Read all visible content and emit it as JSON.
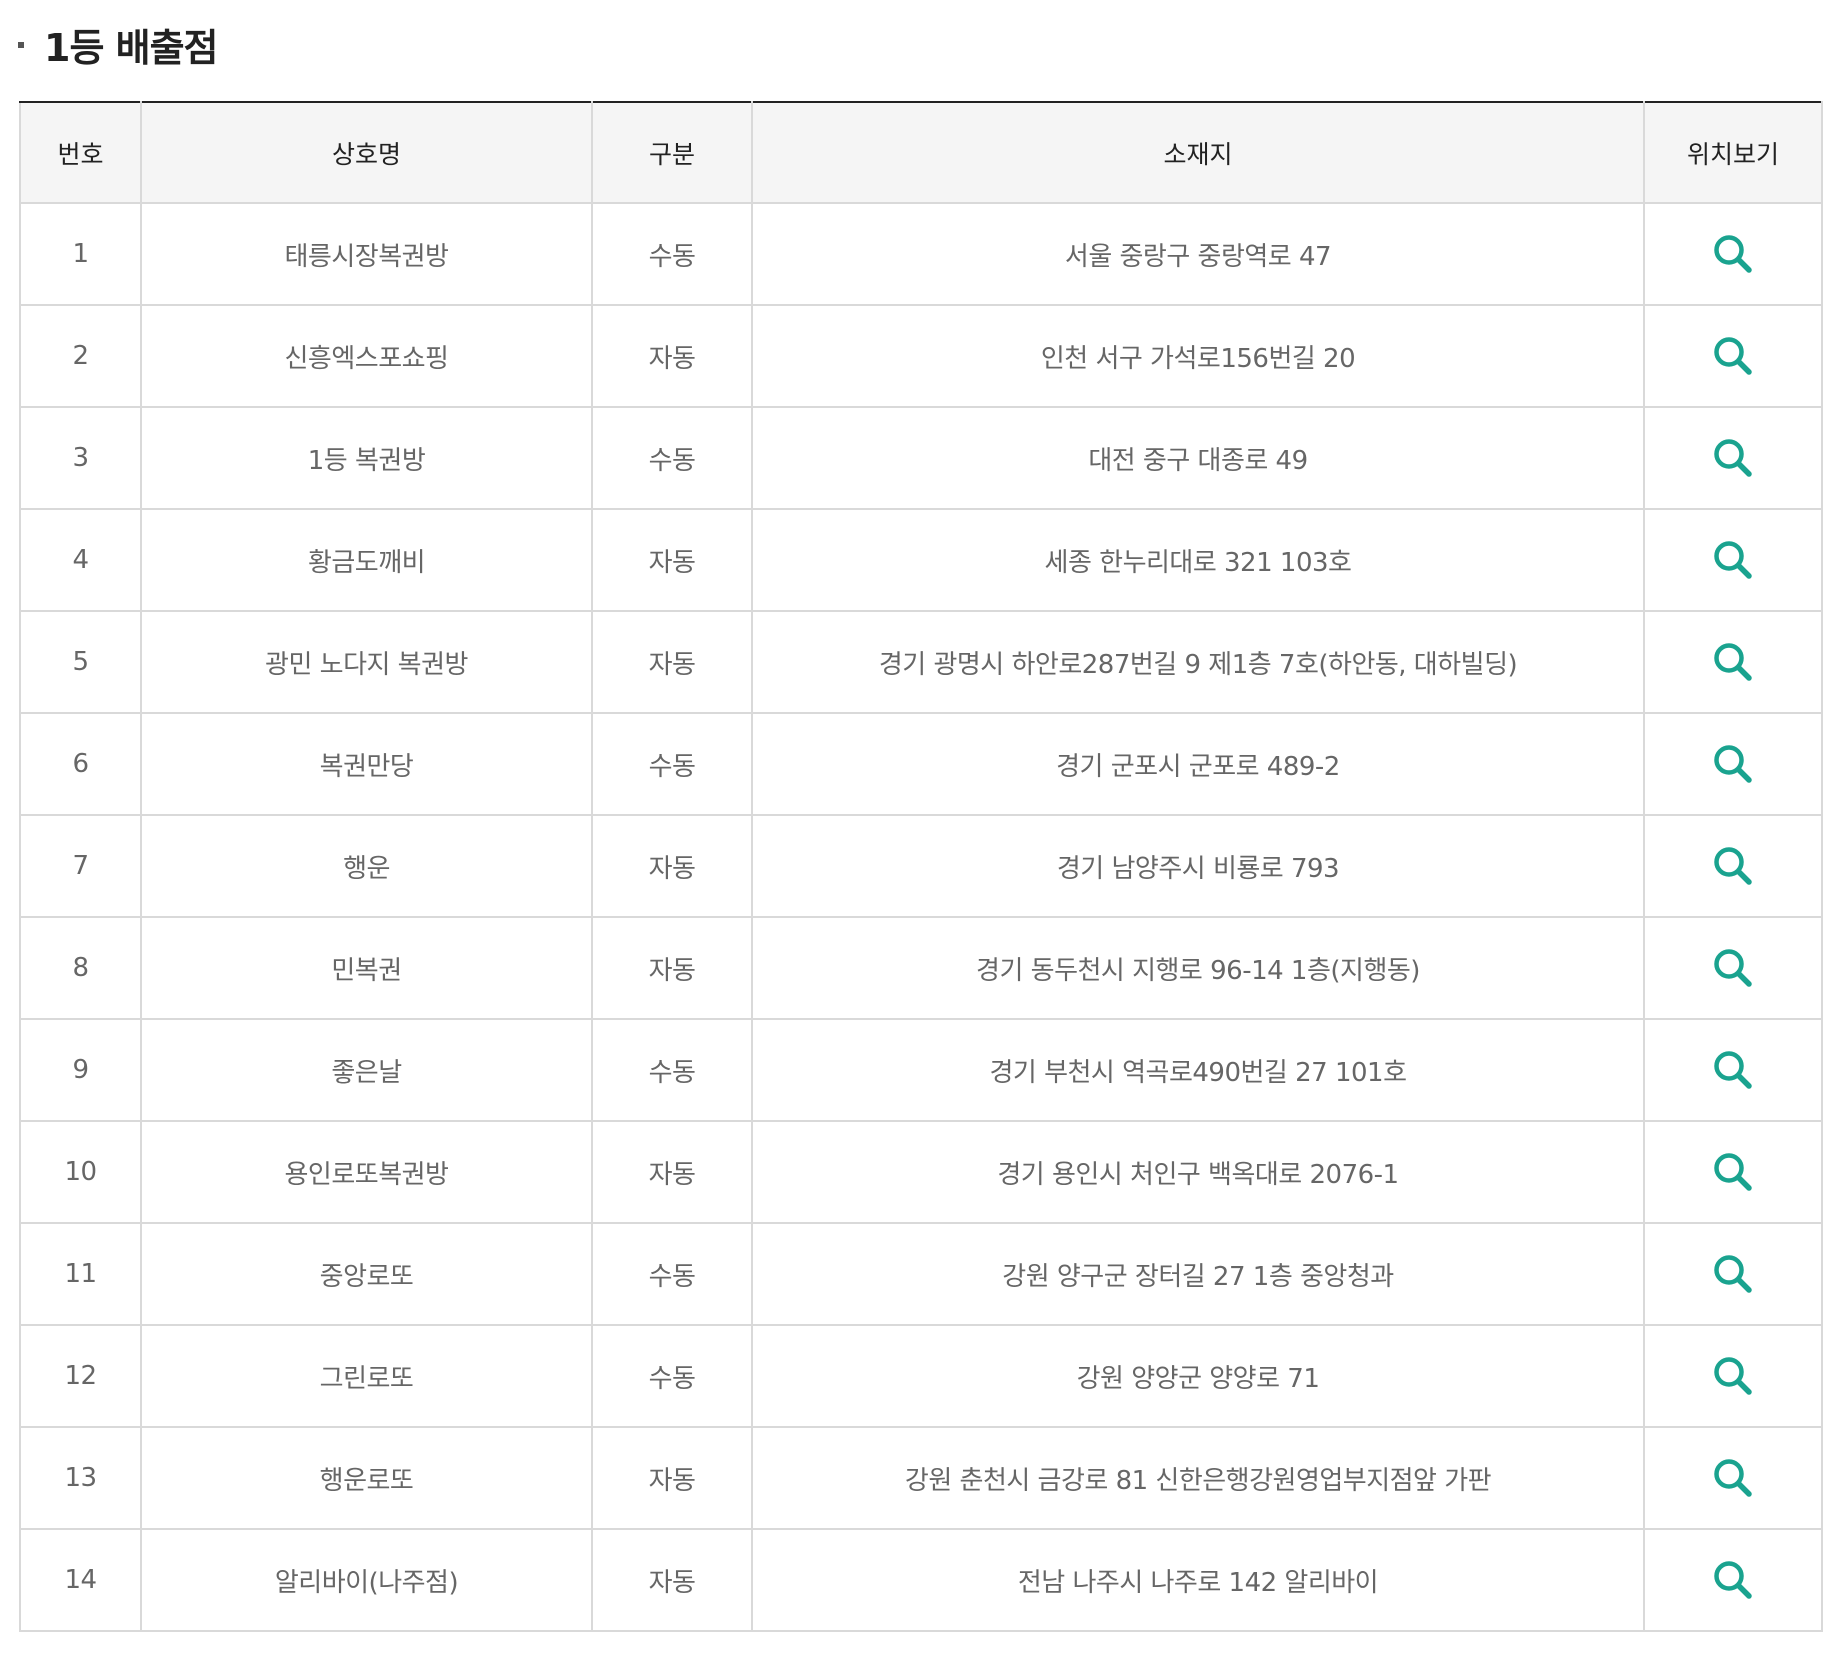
{
  "section": {
    "title": "1등 배출점"
  },
  "table": {
    "headers": {
      "no": "번호",
      "name": "상호명",
      "type": "구분",
      "address": "소재지",
      "location": "위치보기"
    },
    "rows": [
      {
        "no": "1",
        "name": "태릉시장복권방",
        "type": "수동",
        "address": "서울 중랑구 중랑역로 47"
      },
      {
        "no": "2",
        "name": "신흥엑스포쇼핑",
        "type": "자동",
        "address": "인천 서구 가석로156번길 20"
      },
      {
        "no": "3",
        "name": "1등 복권방",
        "type": "수동",
        "address": "대전 중구 대종로 49"
      },
      {
        "no": "4",
        "name": "황금도깨비",
        "type": "자동",
        "address": "세종 한누리대로 321 103호"
      },
      {
        "no": "5",
        "name": "광민 노다지 복권방",
        "type": "자동",
        "address": "경기 광명시 하안로287번길 9 제1층 7호(하안동, 대하빌딩)"
      },
      {
        "no": "6",
        "name": "복권만당",
        "type": "수동",
        "address": "경기 군포시 군포로 489-2"
      },
      {
        "no": "7",
        "name": "행운",
        "type": "자동",
        "address": "경기 남양주시 비룡로 793"
      },
      {
        "no": "8",
        "name": "민복권",
        "type": "자동",
        "address": "경기 동두천시 지행로 96-14 1층(지행동)"
      },
      {
        "no": "9",
        "name": "좋은날",
        "type": "수동",
        "address": "경기 부천시 역곡로490번길 27 101호"
      },
      {
        "no": "10",
        "name": "용인로또복권방",
        "type": "자동",
        "address": "경기 용인시 처인구 백옥대로 2076-1"
      },
      {
        "no": "11",
        "name": "중앙로또",
        "type": "수동",
        "address": "강원 양구군 장터길 27 1층 중앙청과"
      },
      {
        "no": "12",
        "name": "그린로또",
        "type": "수동",
        "address": "강원 양양군 양양로 71"
      },
      {
        "no": "13",
        "name": "행운로또",
        "type": "자동",
        "address": "강원 춘천시 금강로 81 신한은행강원영업부지점앞 가판"
      },
      {
        "no": "14",
        "name": "알리바이(나주점)",
        "type": "자동",
        "address": "전남 나주시 나주로 142 알리바이"
      }
    ]
  },
  "icons": {
    "location": "search-icon"
  },
  "colors": {
    "icon_accent": "#1aa38f",
    "header_bg": "#f5f5f5",
    "top_border": "#222222"
  }
}
